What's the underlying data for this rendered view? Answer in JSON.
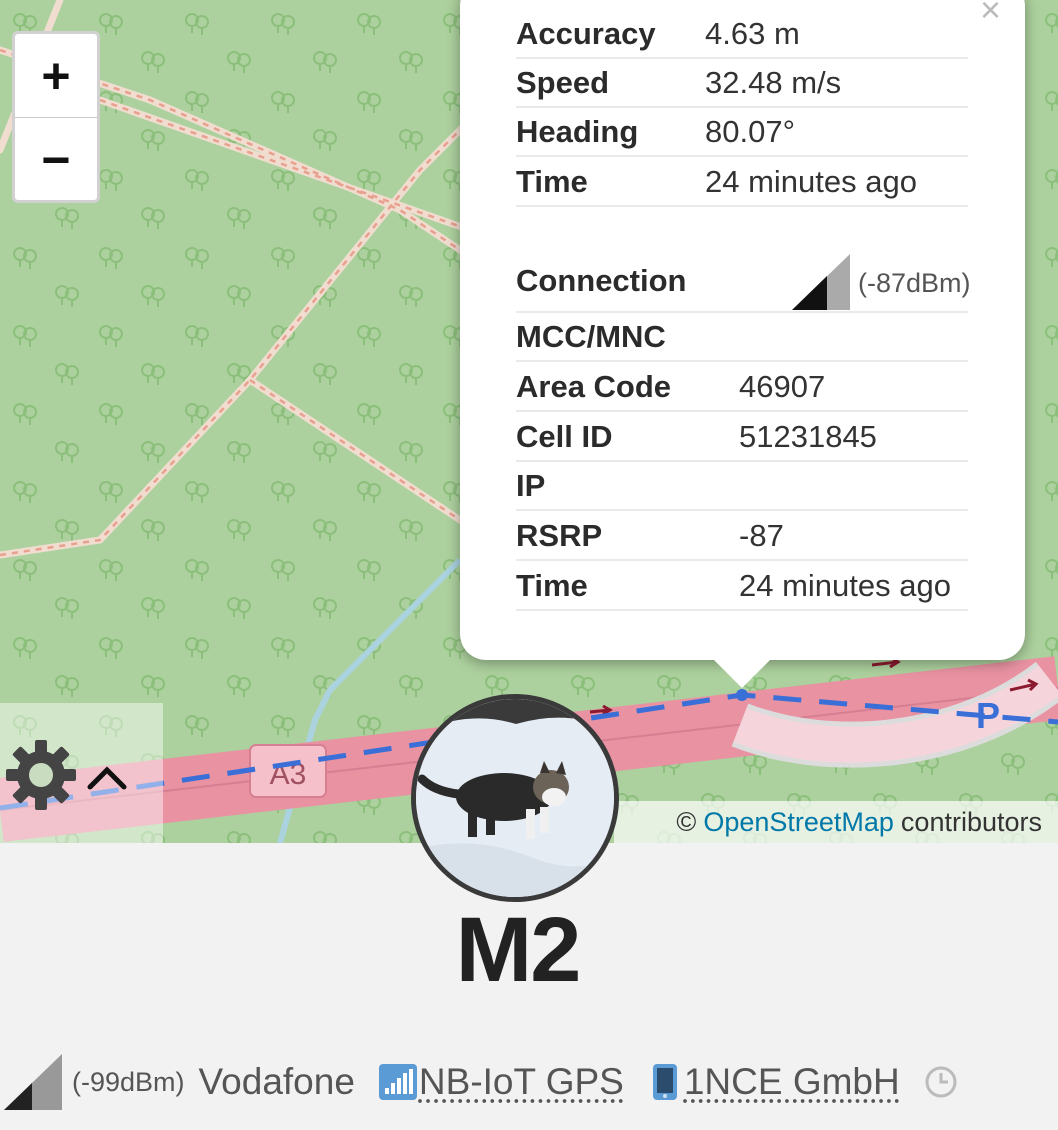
{
  "map": {
    "zoom_in_label": "+",
    "zoom_out_label": "−",
    "road_label": "A3",
    "parking_label": "P",
    "attribution": {
      "prefix": "©",
      "link": "OpenStreetMap",
      "suffix": "contributors"
    }
  },
  "popup": {
    "close_label": "×",
    "location": [
      {
        "key": "Accuracy",
        "value": "4.63 m"
      },
      {
        "key": "Speed",
        "value": "32.48 m/s"
      },
      {
        "key": "Heading",
        "value": "80.07°"
      },
      {
        "key": "Time",
        "value": "24 minutes ago"
      }
    ],
    "connection": {
      "label": "Connection",
      "signal_dbm": "(-87dBm)",
      "signal_level": 0.5
    },
    "cell": [
      {
        "key": "MCC/MNC",
        "value": ""
      },
      {
        "key": "Area Code",
        "value": "46907"
      },
      {
        "key": "Cell ID",
        "value": "51231845"
      },
      {
        "key": "IP",
        "value": ""
      },
      {
        "key": "RSRP",
        "value": "-87"
      },
      {
        "key": "Time",
        "value": "24 minutes ago"
      }
    ]
  },
  "device": {
    "name": "M2",
    "avatar": "cat-photo"
  },
  "footer": {
    "signal_dbm": "(-99dBm)",
    "signal_level": 0.25,
    "operator": "Vodafone",
    "network_icon": "signal-bars-icon",
    "network": "NB-IoT GPS",
    "sim_icon": "phone-icon",
    "provider": "1NCE GmbH",
    "time_icon": "clock-icon"
  },
  "colors": {
    "map_green": "#add19e",
    "motorway": "#e892a2",
    "track_blue": "#3a6fd8",
    "link": "#0078a8"
  }
}
